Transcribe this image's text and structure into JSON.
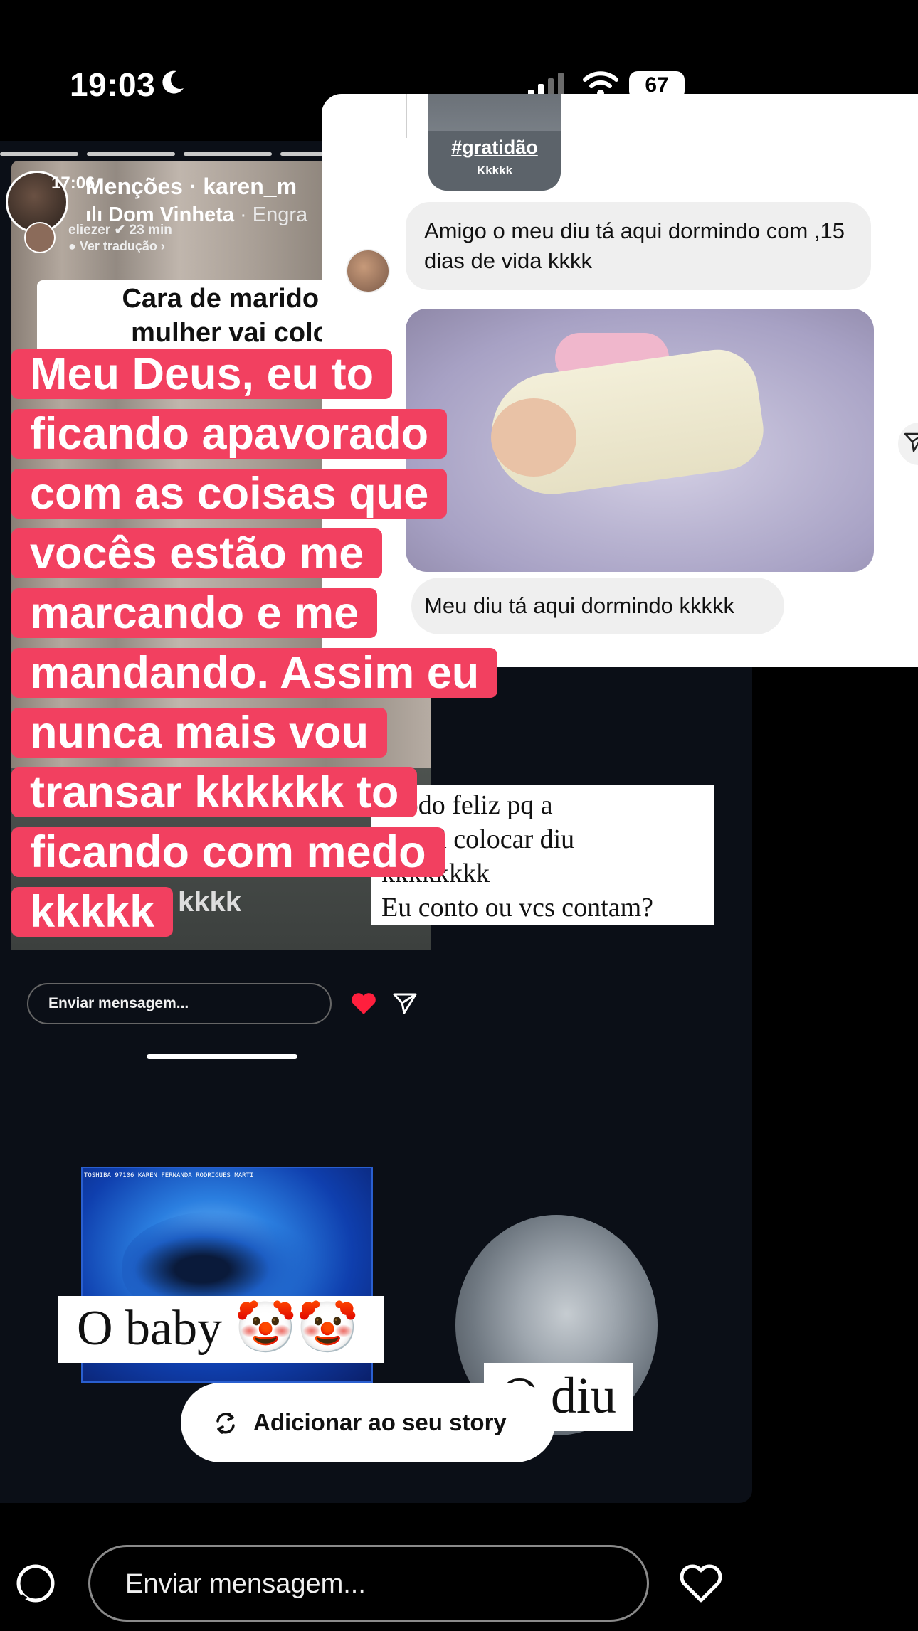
{
  "status_bar": {
    "time": "19:03",
    "battery": "67"
  },
  "mention_story": {
    "time": "17:06",
    "title": "Menções · karen_m",
    "music": "Dom Vinheta",
    "music_suffix": "· Engra",
    "sub_user": "eliezer",
    "sub_user_time": "23 min",
    "sub_translate": "Ver tradução",
    "caption_lines": [
      "Cara de marido feliz",
      "mulher vai colocar"
    ],
    "bottom_text": "kkkk",
    "message_placeholder": "Enviar mensagem...",
    "heart_color": "#ff1f3d"
  },
  "overlay_text": {
    "color": "#f24060",
    "lines": [
      "Meu Deus, eu to",
      "ficando apavorado",
      "com as coisas que",
      "vocês estão me",
      "marcando e me",
      "mandando. Assim eu",
      "nunca mais vou",
      "transar kkkkkk to",
      "ficando com medo",
      "kkkkk"
    ]
  },
  "dm_screenshot": {
    "sticker_hashtag": "#gratidão",
    "sticker_sub": "Kkkkk",
    "message1": "Amigo o meu diu tá aqui dormindo com ,15 dias de vida kkkk",
    "message2": "Meu diu tá aqui dormindo kkkkk"
  },
  "serif_sticker": {
    "lines": [
      "r todo feliz pq a",
      "be vai colocar diu",
      "kkkkkkkk",
      "Eu conto ou vcs contam?"
    ]
  },
  "ultrasound": {
    "header": "TOSHIBA 97106 KAREN FERNANDA RODRIGUES MARTI",
    "baby_label": "O baby 🤡🤡",
    "diu_label": "O diu"
  },
  "add_story": {
    "label": "Adicionar ao seu story"
  },
  "bottom_bar": {
    "message_placeholder": "Enviar mensagem..."
  }
}
